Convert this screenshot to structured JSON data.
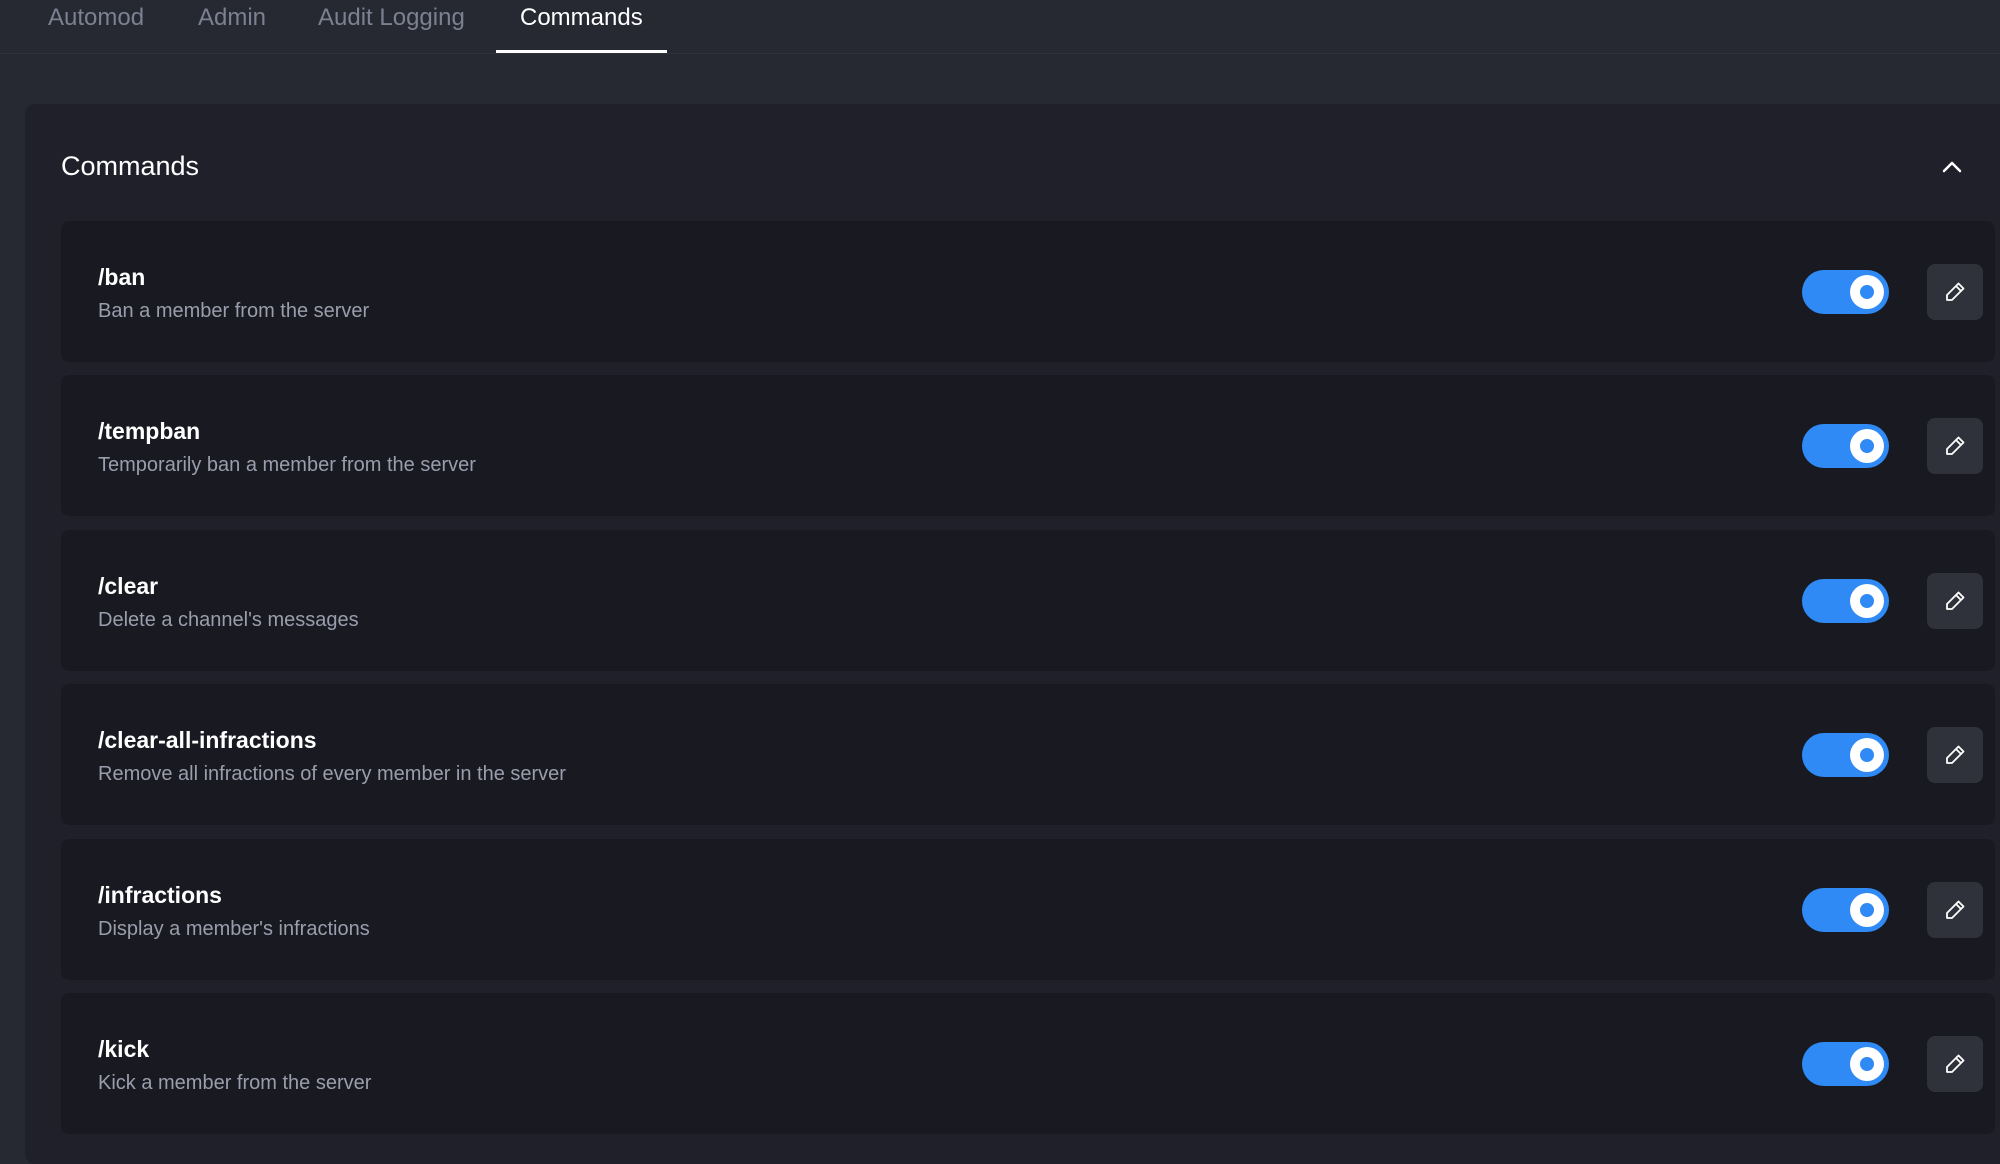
{
  "tabs": [
    {
      "label": "Automod",
      "active": false
    },
    {
      "label": "Admin",
      "active": false
    },
    {
      "label": "Audit Logging",
      "active": false
    },
    {
      "label": "Commands",
      "active": true
    }
  ],
  "panel": {
    "title": "Commands",
    "collapse_icon": "chevron-up-icon"
  },
  "commands": [
    {
      "name": "/ban",
      "description": "Ban a member from the server",
      "enabled": true
    },
    {
      "name": "/tempban",
      "description": "Temporarily ban a member from the server",
      "enabled": true
    },
    {
      "name": "/clear",
      "description": "Delete a channel's messages",
      "enabled": true
    },
    {
      "name": "/clear-all-infractions",
      "description": "Remove all infractions of every member in the server",
      "enabled": true
    },
    {
      "name": "/infractions",
      "description": "Display a member's infractions",
      "enabled": true
    },
    {
      "name": "/kick",
      "description": "Kick a member from the server",
      "enabled": true
    }
  ],
  "icons": {
    "edit": "pencil-icon"
  },
  "colors": {
    "accent": "#2f8af5",
    "background": "#262832",
    "panel": "#1f2029",
    "card": "#191a21"
  }
}
